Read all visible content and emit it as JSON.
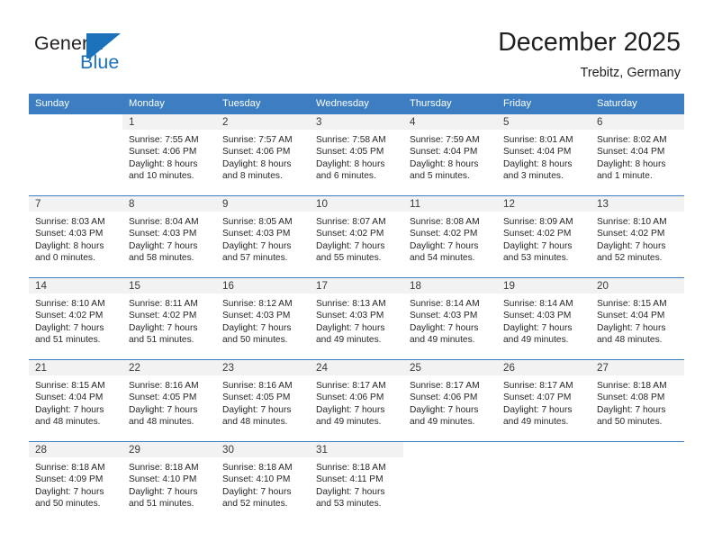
{
  "brand": {
    "name_part1": "General",
    "name_part2": "Blue",
    "accent_color": "#1b72bb"
  },
  "header": {
    "month_title": "December 2025",
    "location": "Trebitz, Germany"
  },
  "calendar": {
    "header_color": "#3c7ec1",
    "weekday_headers": [
      "Sunday",
      "Monday",
      "Tuesday",
      "Wednesday",
      "Thursday",
      "Friday",
      "Saturday"
    ],
    "weeks": [
      [
        {
          "day": "",
          "sunrise": "",
          "sunset": "",
          "daylight_line1": "",
          "daylight_line2": ""
        },
        {
          "day": "1",
          "sunrise": "Sunrise: 7:55 AM",
          "sunset": "Sunset: 4:06 PM",
          "daylight_line1": "Daylight: 8 hours",
          "daylight_line2": "and 10 minutes."
        },
        {
          "day": "2",
          "sunrise": "Sunrise: 7:57 AM",
          "sunset": "Sunset: 4:06 PM",
          "daylight_line1": "Daylight: 8 hours",
          "daylight_line2": "and 8 minutes."
        },
        {
          "day": "3",
          "sunrise": "Sunrise: 7:58 AM",
          "sunset": "Sunset: 4:05 PM",
          "daylight_line1": "Daylight: 8 hours",
          "daylight_line2": "and 6 minutes."
        },
        {
          "day": "4",
          "sunrise": "Sunrise: 7:59 AM",
          "sunset": "Sunset: 4:04 PM",
          "daylight_line1": "Daylight: 8 hours",
          "daylight_line2": "and 5 minutes."
        },
        {
          "day": "5",
          "sunrise": "Sunrise: 8:01 AM",
          "sunset": "Sunset: 4:04 PM",
          "daylight_line1": "Daylight: 8 hours",
          "daylight_line2": "and 3 minutes."
        },
        {
          "day": "6",
          "sunrise": "Sunrise: 8:02 AM",
          "sunset": "Sunset: 4:04 PM",
          "daylight_line1": "Daylight: 8 hours",
          "daylight_line2": "and 1 minute."
        }
      ],
      [
        {
          "day": "7",
          "sunrise": "Sunrise: 8:03 AM",
          "sunset": "Sunset: 4:03 PM",
          "daylight_line1": "Daylight: 8 hours",
          "daylight_line2": "and 0 minutes."
        },
        {
          "day": "8",
          "sunrise": "Sunrise: 8:04 AM",
          "sunset": "Sunset: 4:03 PM",
          "daylight_line1": "Daylight: 7 hours",
          "daylight_line2": "and 58 minutes."
        },
        {
          "day": "9",
          "sunrise": "Sunrise: 8:05 AM",
          "sunset": "Sunset: 4:03 PM",
          "daylight_line1": "Daylight: 7 hours",
          "daylight_line2": "and 57 minutes."
        },
        {
          "day": "10",
          "sunrise": "Sunrise: 8:07 AM",
          "sunset": "Sunset: 4:02 PM",
          "daylight_line1": "Daylight: 7 hours",
          "daylight_line2": "and 55 minutes."
        },
        {
          "day": "11",
          "sunrise": "Sunrise: 8:08 AM",
          "sunset": "Sunset: 4:02 PM",
          "daylight_line1": "Daylight: 7 hours",
          "daylight_line2": "and 54 minutes."
        },
        {
          "day": "12",
          "sunrise": "Sunrise: 8:09 AM",
          "sunset": "Sunset: 4:02 PM",
          "daylight_line1": "Daylight: 7 hours",
          "daylight_line2": "and 53 minutes."
        },
        {
          "day": "13",
          "sunrise": "Sunrise: 8:10 AM",
          "sunset": "Sunset: 4:02 PM",
          "daylight_line1": "Daylight: 7 hours",
          "daylight_line2": "and 52 minutes."
        }
      ],
      [
        {
          "day": "14",
          "sunrise": "Sunrise: 8:10 AM",
          "sunset": "Sunset: 4:02 PM",
          "daylight_line1": "Daylight: 7 hours",
          "daylight_line2": "and 51 minutes."
        },
        {
          "day": "15",
          "sunrise": "Sunrise: 8:11 AM",
          "sunset": "Sunset: 4:02 PM",
          "daylight_line1": "Daylight: 7 hours",
          "daylight_line2": "and 51 minutes."
        },
        {
          "day": "16",
          "sunrise": "Sunrise: 8:12 AM",
          "sunset": "Sunset: 4:03 PM",
          "daylight_line1": "Daylight: 7 hours",
          "daylight_line2": "and 50 minutes."
        },
        {
          "day": "17",
          "sunrise": "Sunrise: 8:13 AM",
          "sunset": "Sunset: 4:03 PM",
          "daylight_line1": "Daylight: 7 hours",
          "daylight_line2": "and 49 minutes."
        },
        {
          "day": "18",
          "sunrise": "Sunrise: 8:14 AM",
          "sunset": "Sunset: 4:03 PM",
          "daylight_line1": "Daylight: 7 hours",
          "daylight_line2": "and 49 minutes."
        },
        {
          "day": "19",
          "sunrise": "Sunrise: 8:14 AM",
          "sunset": "Sunset: 4:03 PM",
          "daylight_line1": "Daylight: 7 hours",
          "daylight_line2": "and 49 minutes."
        },
        {
          "day": "20",
          "sunrise": "Sunrise: 8:15 AM",
          "sunset": "Sunset: 4:04 PM",
          "daylight_line1": "Daylight: 7 hours",
          "daylight_line2": "and 48 minutes."
        }
      ],
      [
        {
          "day": "21",
          "sunrise": "Sunrise: 8:15 AM",
          "sunset": "Sunset: 4:04 PM",
          "daylight_line1": "Daylight: 7 hours",
          "daylight_line2": "and 48 minutes."
        },
        {
          "day": "22",
          "sunrise": "Sunrise: 8:16 AM",
          "sunset": "Sunset: 4:05 PM",
          "daylight_line1": "Daylight: 7 hours",
          "daylight_line2": "and 48 minutes."
        },
        {
          "day": "23",
          "sunrise": "Sunrise: 8:16 AM",
          "sunset": "Sunset: 4:05 PM",
          "daylight_line1": "Daylight: 7 hours",
          "daylight_line2": "and 48 minutes."
        },
        {
          "day": "24",
          "sunrise": "Sunrise: 8:17 AM",
          "sunset": "Sunset: 4:06 PM",
          "daylight_line1": "Daylight: 7 hours",
          "daylight_line2": "and 49 minutes."
        },
        {
          "day": "25",
          "sunrise": "Sunrise: 8:17 AM",
          "sunset": "Sunset: 4:06 PM",
          "daylight_line1": "Daylight: 7 hours",
          "daylight_line2": "and 49 minutes."
        },
        {
          "day": "26",
          "sunrise": "Sunrise: 8:17 AM",
          "sunset": "Sunset: 4:07 PM",
          "daylight_line1": "Daylight: 7 hours",
          "daylight_line2": "and 49 minutes."
        },
        {
          "day": "27",
          "sunrise": "Sunrise: 8:18 AM",
          "sunset": "Sunset: 4:08 PM",
          "daylight_line1": "Daylight: 7 hours",
          "daylight_line2": "and 50 minutes."
        }
      ],
      [
        {
          "day": "28",
          "sunrise": "Sunrise: 8:18 AM",
          "sunset": "Sunset: 4:09 PM",
          "daylight_line1": "Daylight: 7 hours",
          "daylight_line2": "and 50 minutes."
        },
        {
          "day": "29",
          "sunrise": "Sunrise: 8:18 AM",
          "sunset": "Sunset: 4:10 PM",
          "daylight_line1": "Daylight: 7 hours",
          "daylight_line2": "and 51 minutes."
        },
        {
          "day": "30",
          "sunrise": "Sunrise: 8:18 AM",
          "sunset": "Sunset: 4:10 PM",
          "daylight_line1": "Daylight: 7 hours",
          "daylight_line2": "and 52 minutes."
        },
        {
          "day": "31",
          "sunrise": "Sunrise: 8:18 AM",
          "sunset": "Sunset: 4:11 PM",
          "daylight_line1": "Daylight: 7 hours",
          "daylight_line2": "and 53 minutes."
        },
        {
          "day": "",
          "sunrise": "",
          "sunset": "",
          "daylight_line1": "",
          "daylight_line2": ""
        },
        {
          "day": "",
          "sunrise": "",
          "sunset": "",
          "daylight_line1": "",
          "daylight_line2": ""
        },
        {
          "day": "",
          "sunrise": "",
          "sunset": "",
          "daylight_line1": "",
          "daylight_line2": ""
        }
      ]
    ]
  }
}
